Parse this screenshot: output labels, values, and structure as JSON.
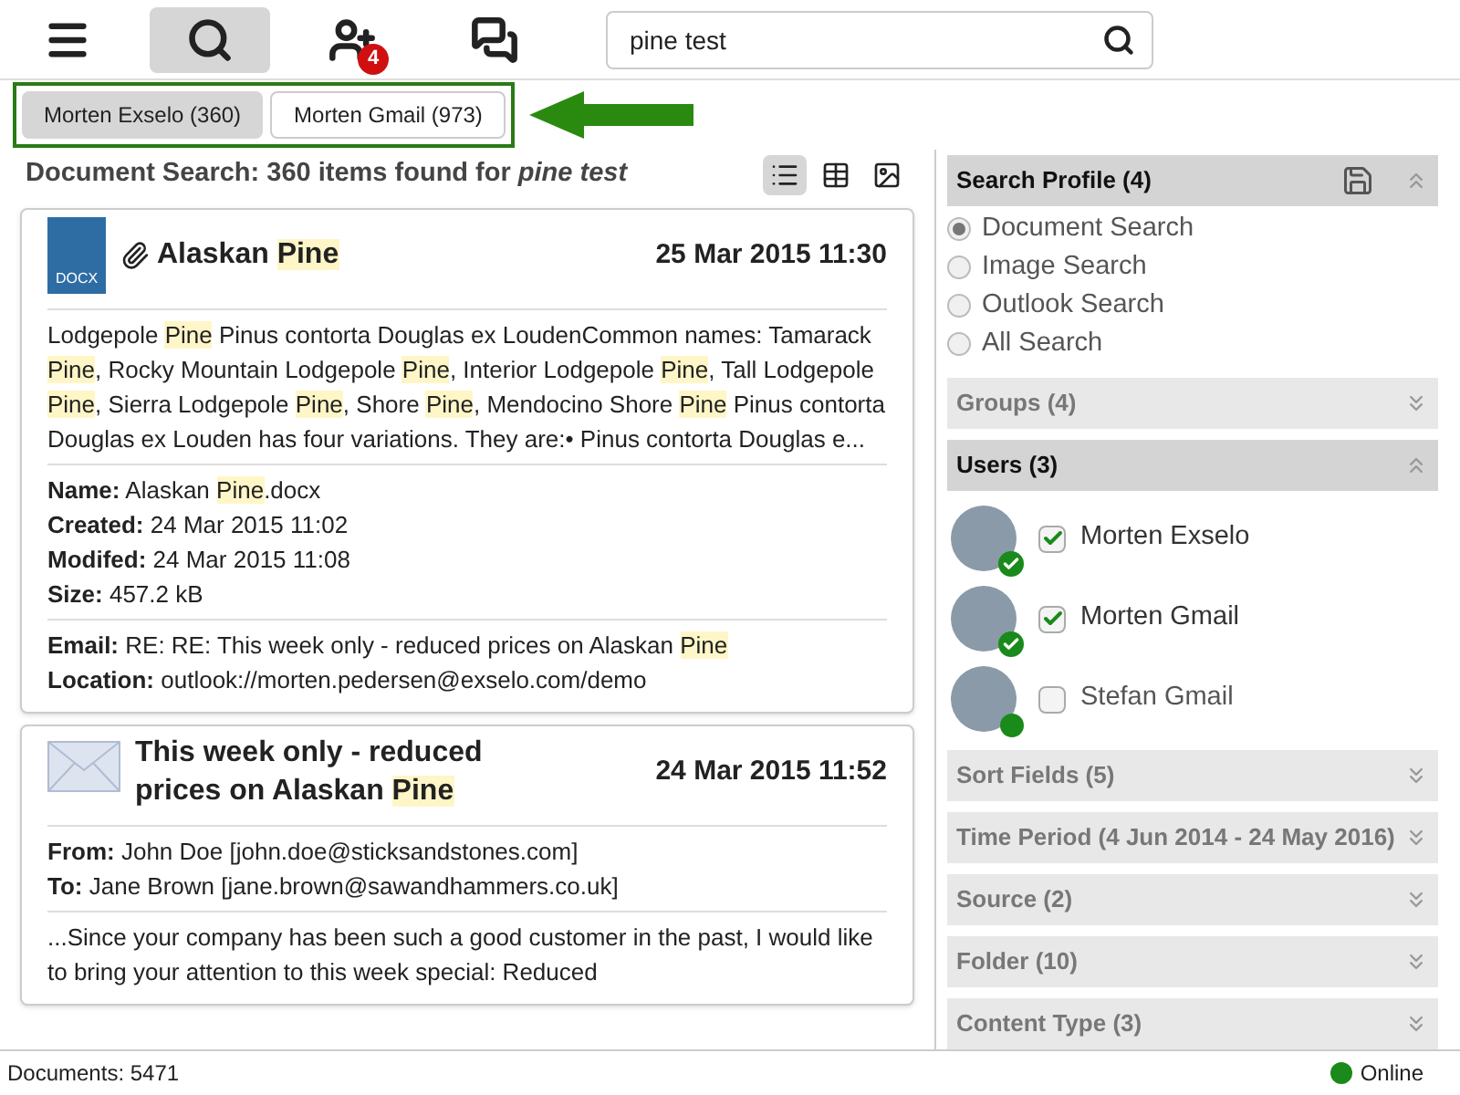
{
  "toolbar": {
    "buttons": [
      {
        "kind": "menu",
        "selected": false
      },
      {
        "kind": "search",
        "selected": true
      },
      {
        "kind": "add-user",
        "selected": false,
        "badge": "4"
      },
      {
        "kind": "chat",
        "selected": false
      }
    ],
    "search": {
      "value": "pine test"
    }
  },
  "account_tabs": [
    {
      "label": "Morten Exselo (360)",
      "selected": true
    },
    {
      "label": "Morten Gmail (973)",
      "selected": false
    }
  ],
  "results_header": {
    "title": "Document Search: 360 items found for *pine test*",
    "views": [
      {
        "kind": "list",
        "selected": true
      },
      {
        "kind": "grid",
        "selected": false
      },
      {
        "kind": "image",
        "selected": false
      }
    ]
  },
  "results": [
    {
      "kind": "document",
      "file_type": "DOCX",
      "attachment": true,
      "title": [
        {
          "text": "Alaskan ",
          "highlight": false
        },
        {
          "text": "Pine",
          "highlight": true
        }
      ],
      "date": "25 Mar 2015 11:30",
      "summary": [
        {
          "text": "Lodgepole ",
          "highlight": false
        },
        {
          "text": "Pine",
          "highlight": true
        },
        {
          "text": " Pinus contorta Douglas ex LoudenCommon names: Tamarack ",
          "highlight": false
        },
        {
          "text": "Pine",
          "highlight": true
        },
        {
          "text": ", Rocky Mountain Lodgepole ",
          "highlight": false
        },
        {
          "text": "Pine",
          "highlight": true
        },
        {
          "text": ", Interior Lodgepole ",
          "highlight": false
        },
        {
          "text": "Pine",
          "highlight": true
        },
        {
          "text": ", Tall Lodgepole ",
          "highlight": false
        },
        {
          "text": "Pine",
          "highlight": true
        },
        {
          "text": ", Sierra Lodgepole ",
          "highlight": false
        },
        {
          "text": "Pine",
          "highlight": true
        },
        {
          "text": ", Shore ",
          "highlight": false
        },
        {
          "text": "Pine",
          "highlight": true
        },
        {
          "text": ", Mendocino Shore ",
          "highlight": false
        },
        {
          "text": "Pine",
          "highlight": true
        },
        {
          "text": " Pinus contorta Douglas ex Louden has four variations. They are:• Pinus contorta Douglas e...",
          "highlight": false
        }
      ],
      "sections": [
        [
          {
            "label": "Name:",
            "value": [
              {
                "text": "Alaskan ",
                "highlight": false
              },
              {
                "text": "Pine",
                "highlight": true
              },
              {
                "text": ".docx",
                "highlight": false
              }
            ]
          },
          {
            "label": "Created:",
            "value": [
              {
                "text": "24 Mar 2015 11:02",
                "highlight": false
              }
            ]
          },
          {
            "label": "Modifed:",
            "value": [
              {
                "text": "24 Mar 2015 11:08",
                "highlight": false
              }
            ]
          },
          {
            "label": "Size:",
            "value": [
              {
                "text": "457.2 kB",
                "highlight": false
              }
            ]
          }
        ],
        [
          {
            "label": "Email:",
            "value": [
              {
                "text": "RE: RE: This week only - reduced prices on Alaskan ",
                "highlight": false
              },
              {
                "text": "Pine",
                "highlight": true
              }
            ]
          },
          {
            "label": "Location:",
            "value": [
              {
                "text": "outlook://morten.pedersen@exselo.com/demo",
                "highlight": false
              }
            ]
          }
        ]
      ]
    },
    {
      "kind": "email",
      "attachment": false,
      "title": [
        {
          "text": "This week only - reduced prices on Alaskan ",
          "highlight": false
        },
        {
          "text": "Pine",
          "highlight": true
        }
      ],
      "date": "24 Mar 2015 11:52",
      "headers": [
        {
          "label": "From:",
          "value": [
            {
              "text": "John Doe [john.doe@sticksandstones.com]",
              "highlight": false
            }
          ]
        },
        {
          "label": "To:",
          "value": [
            {
              "text": "Jane Brown [jane.brown@sawandhammers.co.uk]",
              "highlight": false
            }
          ]
        }
      ],
      "summary": [
        {
          "text": "...Since your company has been such a good customer in the past, I would like to bring your attention to this week special: Reduced",
          "highlight": false
        }
      ]
    }
  ],
  "sidebar": {
    "panels": [
      {
        "title": "Search Profile (4)",
        "expanded": true,
        "kind": "radio",
        "save": true,
        "items": [
          {
            "label": "Document Search",
            "selected": true
          },
          {
            "label": "Image Search",
            "selected": false
          },
          {
            "label": "Outlook Search",
            "selected": false
          },
          {
            "label": "All Search",
            "selected": false
          }
        ]
      },
      {
        "title": "Groups (4)",
        "expanded": false,
        "kind": "plain",
        "save": false
      },
      {
        "title": "Users (3)",
        "expanded": true,
        "kind": "users",
        "save": false,
        "items": [
          {
            "name": "Morten Exselo",
            "checked": true,
            "kind": "verified"
          },
          {
            "name": "Morten Gmail",
            "checked": true,
            "kind": "verified"
          },
          {
            "name": "Stefan Gmail",
            "checked": false,
            "kind": "online"
          }
        ]
      },
      {
        "title": "Sort Fields (5)",
        "expanded": false,
        "kind": "plain",
        "save": false
      },
      {
        "title": "Time Period (4 Jun 2014 - 24 May 2016)",
        "expanded": false,
        "kind": "plain",
        "save": false
      },
      {
        "title": "Source (2)",
        "expanded": false,
        "kind": "plain",
        "save": false
      },
      {
        "title": "Folder (10)",
        "expanded": false,
        "kind": "plain",
        "save": false
      },
      {
        "title": "Content Type (3)",
        "expanded": false,
        "kind": "plain",
        "save": false
      }
    ]
  },
  "status_bar": {
    "documents": "Documents: 5471",
    "connection": "Online",
    "online": true
  }
}
